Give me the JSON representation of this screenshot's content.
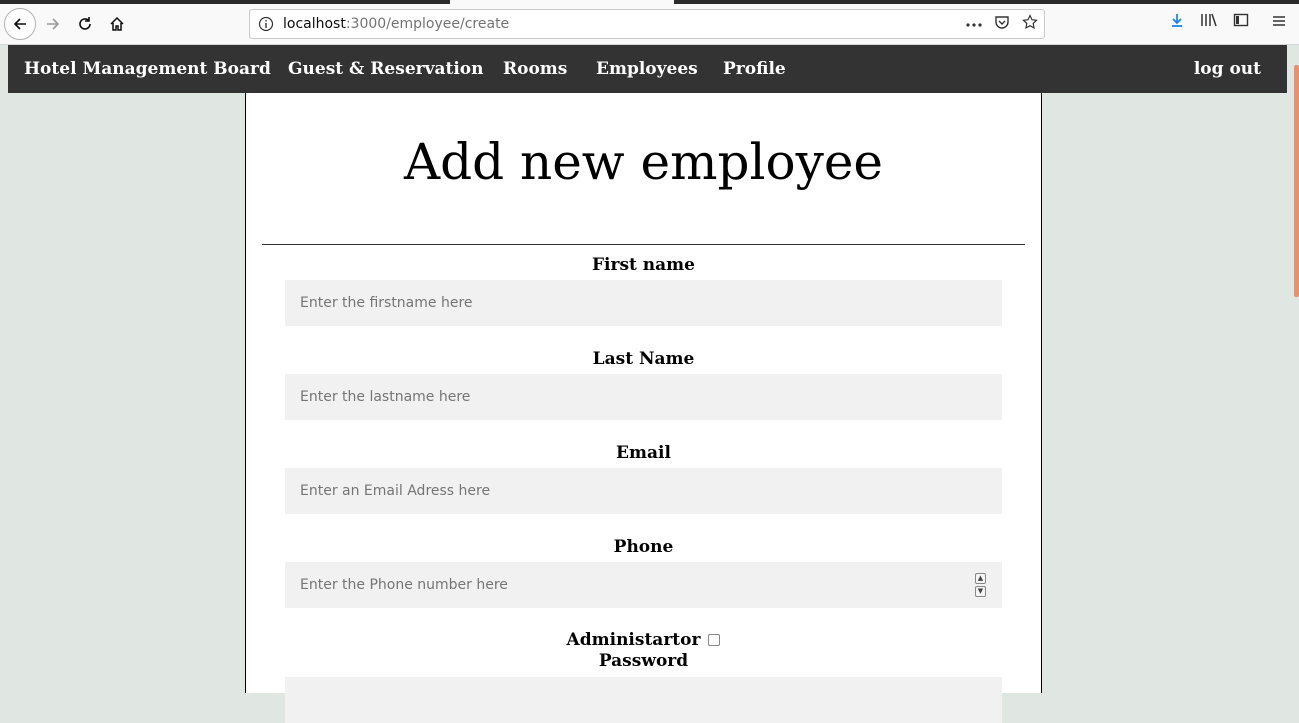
{
  "browser": {
    "url_host": "localhost",
    "url_path": ":3000/employee/create",
    "page_actions_icon": "more-icon",
    "pocket_icon": "pocket-icon",
    "bookmark_icon": "star-icon"
  },
  "nav": {
    "brand": "Hotel Management Board",
    "items": [
      "Guest & Reservation",
      "Rooms",
      "Employees",
      "Profile"
    ],
    "logout": "log out",
    "background": "#333333"
  },
  "page": {
    "title": "Add new employee",
    "background": "#e0e7e3"
  },
  "form": {
    "first_name_label": "First name",
    "first_name_placeholder": "Enter the firstname here",
    "last_name_label": "Last Name",
    "last_name_placeholder": "Enter the lastname here",
    "email_label": "Email",
    "email_placeholder": "Enter an Email Adress here",
    "phone_label": "Phone",
    "phone_placeholder": "Enter the Phone number here",
    "admin_label": "Administartor",
    "admin_checked": false,
    "password_label": "Password"
  }
}
